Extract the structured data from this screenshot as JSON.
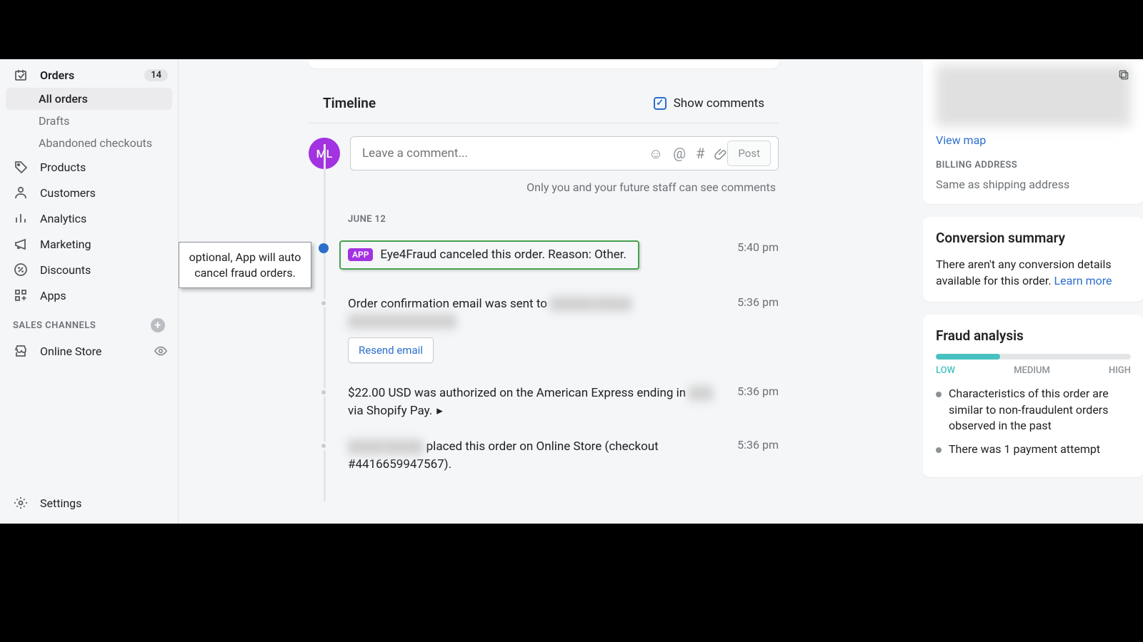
{
  "sidebar": {
    "orders": {
      "label": "Orders",
      "badge": "14"
    },
    "sub": {
      "all": "All orders",
      "drafts": "Drafts",
      "abandoned": "Abandoned checkouts"
    },
    "products": "Products",
    "customers": "Customers",
    "analytics": "Analytics",
    "marketing": "Marketing",
    "discounts": "Discounts",
    "apps": "Apps",
    "sales_channels_header": "SALES CHANNELS",
    "online_store": "Online Store",
    "settings": "Settings"
  },
  "callout": {
    "text": "optional, App will auto cancel fraud orders."
  },
  "timeline": {
    "title": "Timeline",
    "show_comments": "Show comments",
    "avatar": "ML",
    "placeholder": "Leave a comment...",
    "post": "Post",
    "note": "Only you and your future staff can see comments",
    "date": "JUNE 12",
    "items": [
      {
        "badge": "APP",
        "text": "Eye4Fraud canceled this order. Reason: Other.",
        "time": "5:40 pm"
      },
      {
        "text_pre": "Order confirmation email was sent to ",
        "time": "5:36 pm",
        "resend": "Resend email"
      },
      {
        "text_pre": "$22.00 USD was authorized on the American Express ending in ",
        "text_post": " via Shopify Pay.",
        "time": "5:36 pm"
      },
      {
        "text_post": " placed this order on Online Store (checkout #4416659947567).",
        "time": "5:36 pm"
      }
    ]
  },
  "right": {
    "view_map": "View map",
    "billing_heading": "BILLING ADDRESS",
    "billing_text": "Same as shipping address",
    "conversion_title": "Conversion summary",
    "conversion_text_pre": "There aren't any conversion details available for this order. ",
    "learn_more": "Learn more",
    "fraud_title": "Fraud analysis",
    "levels": {
      "low": "LOW",
      "medium": "MEDIUM",
      "high": "HIGH"
    },
    "fraud_items": [
      "Characteristics of this order are similar to non-fraudulent orders observed in the past",
      "There was 1 payment attempt"
    ]
  }
}
